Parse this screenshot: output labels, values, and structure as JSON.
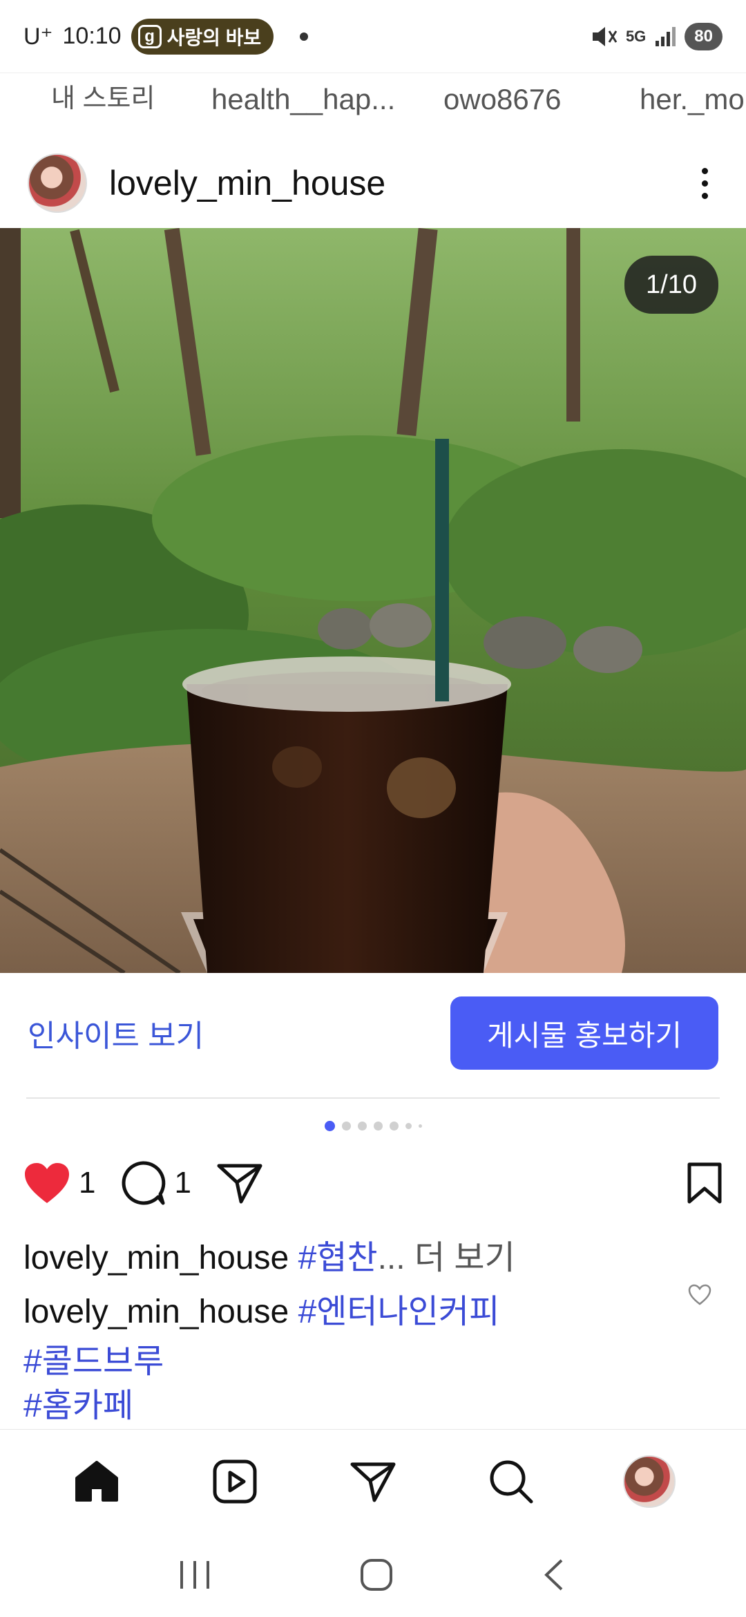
{
  "status_bar": {
    "carrier": "U⁺",
    "time": "10:10",
    "chip_icon": "g",
    "chip_label": "사랑의 바보",
    "network": "5G",
    "battery": "80"
  },
  "stories": [
    {
      "label": "내 스토리"
    },
    {
      "label": "health__hap..."
    },
    {
      "label": "owo8676"
    },
    {
      "label": "her._mo"
    }
  ],
  "post": {
    "username": "lovely_min_house",
    "counter": "1/10",
    "insights_label": "인사이트 보기",
    "promote_label": "게시물 홍보하기",
    "likes": "1",
    "comments": "1",
    "caption1": {
      "user": "lovely_min_house",
      "tag": "#협찬",
      "more": "... 더 보기"
    },
    "caption2": {
      "user": "lovely_min_house",
      "tags": [
        "#엔터나인커피",
        "#콜드브루",
        "#홈카페"
      ]
    }
  },
  "colors": {
    "accent": "#4a5cf5",
    "tag": "#3b4bd6",
    "like": "#ed2a3c"
  },
  "icons": {
    "nav": [
      "home-icon",
      "reels-icon",
      "send-icon",
      "search-icon",
      "profile-avatar"
    ],
    "system": [
      "recents-icon",
      "home-circle-icon",
      "back-icon"
    ]
  }
}
